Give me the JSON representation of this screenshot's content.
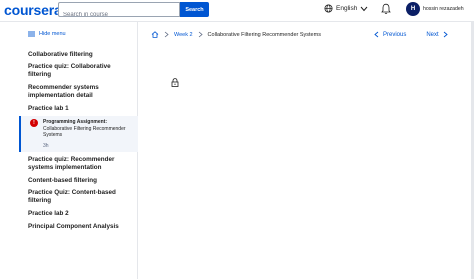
{
  "header": {
    "logo": "coursera",
    "search_placeholder": "Search in course",
    "search_button": "Search",
    "language": "English",
    "avatar_initial": "H",
    "user_name": "hossin rezazadeh"
  },
  "sidebar": {
    "hide_menu": "Hide menu",
    "items": [
      {
        "label": "Collaborative filtering"
      },
      {
        "label": "Practice quiz: Collaborative filtering"
      },
      {
        "label": "Recommender systems implementation detail"
      },
      {
        "label": "Practice lab 1"
      },
      {
        "label": "Practice quiz: Recommender systems implementation"
      },
      {
        "label": "Content-based filtering"
      },
      {
        "label": "Practice Quiz: Content-based filtering"
      },
      {
        "label": "Practice lab 2"
      },
      {
        "label": "Principal Component Analysis"
      }
    ],
    "active": {
      "badge": "!",
      "title": "Programming Assignment:",
      "subtitle": "Collaborative Filtering Recommender Systems",
      "duration": "3h"
    }
  },
  "breadcrumb": {
    "week": "Week 2",
    "page": "Collaborative Filtering Recommender Systems"
  },
  "pager": {
    "previous": "Previous",
    "next": "Next"
  },
  "colors": {
    "brand": "#0056d2",
    "badge": "#d30001",
    "avatar": "#0b1f66"
  }
}
